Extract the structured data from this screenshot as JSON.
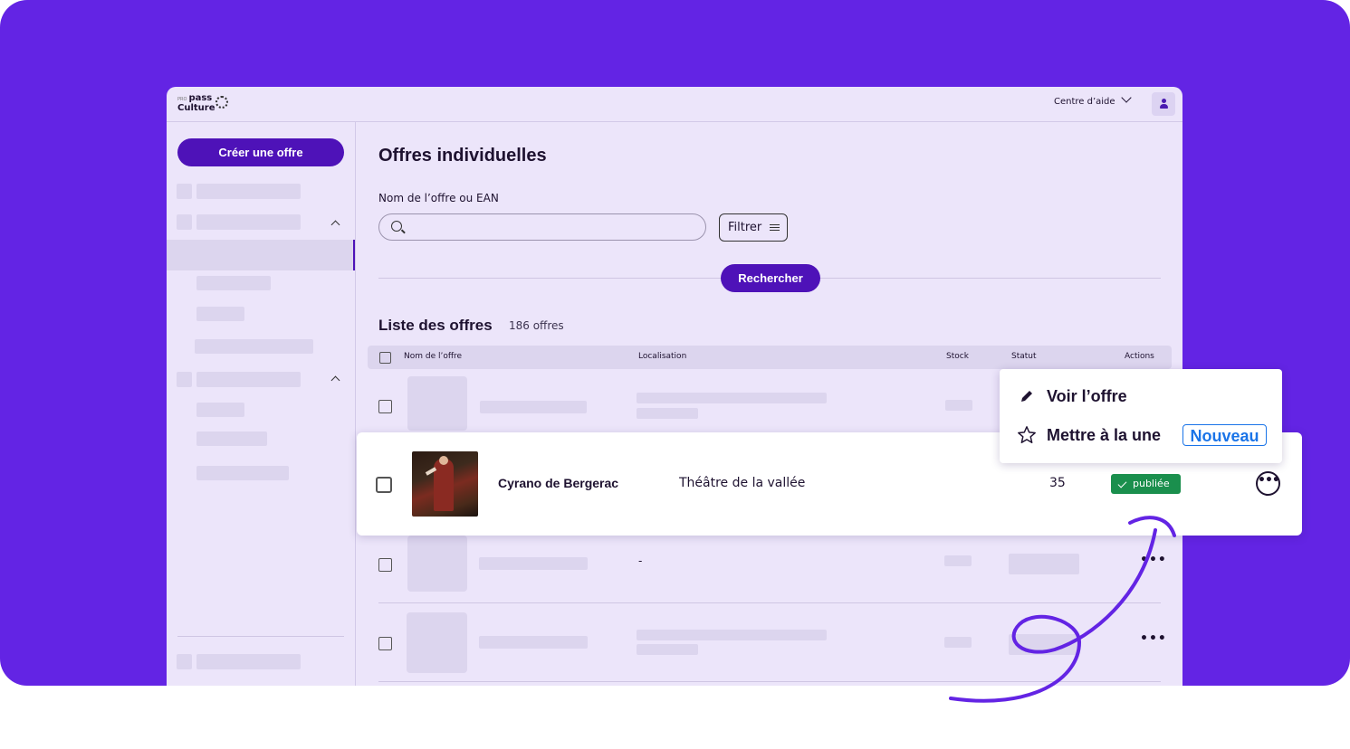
{
  "header": {
    "logo_pro": "PRO",
    "logo_line1": "pass",
    "logo_line2": "Culture",
    "help_label": "Centre d’aide"
  },
  "sidebar": {
    "create_label": "Créer une offre"
  },
  "main": {
    "title": "Offres individuelles",
    "search_label": "Nom de l’offre ou EAN",
    "filter_label": "Filtrer",
    "search_button": "Rechercher",
    "list_title": "Liste des offres",
    "list_count": "186 offres",
    "columns": [
      "Nom de l’offre",
      "Localisation",
      "Stock",
      "Statut",
      "Actions"
    ],
    "row_placeholder_location": "-"
  },
  "offer": {
    "name": "Cyrano de Bergerac",
    "location": "Théâtre de la vallée",
    "stock": "35",
    "status": "publiée",
    "status_color": "#1a8f4d"
  },
  "menu": {
    "items": [
      {
        "label": "Voir l’offre",
        "icon": "pencil-icon"
      },
      {
        "label": "Mettre à la une",
        "icon": "star-icon",
        "badge": "Nouveau"
      }
    ]
  },
  "colors": {
    "brand": "#6324e4",
    "primary_button": "#4e12b8",
    "app_background": "#ece5fa",
    "badge_blue": "#1a74e8"
  }
}
